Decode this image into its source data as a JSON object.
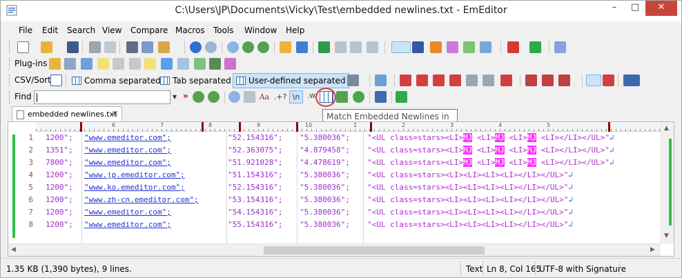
{
  "window": {
    "title": "C:\\Users\\JP\\Documents\\Vicky\\Test\\embedded newlines.txt - EmEditor",
    "minimize": "–",
    "maximize": "□",
    "close": "✕"
  },
  "menu": [
    "File",
    "Edit",
    "Search",
    "View",
    "Compare",
    "Macros",
    "Tools",
    "Window",
    "Help"
  ],
  "plugins_label": "Plug-ins",
  "csv": {
    "label": "CSV/Sort",
    "comma": "Comma separated",
    "tab": "Tab separated",
    "user": "User-defined separated"
  },
  "find": {
    "label": "Find",
    "value": "",
    "options": {
      "regex": ".+?",
      "newline": "\\n",
      "whole": ".W."
    }
  },
  "tooltip": "Match Embedded Newlines in CSV",
  "tab": {
    "name": "embedded newlines.txt",
    "close": "✕"
  },
  "ruler": [
    "6",
    "7",
    "8",
    "9",
    "10",
    "1",
    "2",
    "3",
    "4",
    "5"
  ],
  "lines": [
    {
      "n": "1",
      "c1": "1200\";",
      "c2": "\"www.emeditor.com\";",
      "c3": "\"52.154316\";",
      "c4": "\"5.380036\";",
      "c5": "\"<UL class=stars><LI>",
      "m": "MJ",
      "c6": " <LI>",
      "m2": "MJ",
      "c7": " <LI>",
      "m3": "MJ",
      "c8": " <LI></LI></UL>\"",
      "nl": "↲"
    },
    {
      "n": "2",
      "c1": "1351\";",
      "c2": "\"www.emeditor.com\";",
      "c3": "\"52.363075\";",
      "c4": "\"4.879458\";",
      "c5": "\"<UL class=stars><LI>",
      "m": "MJ",
      "c6": " <LI>",
      "m2": "MJ",
      "c7": " <LI>",
      "m3": "MJ",
      "c8": " <LI></LI></UL>\"",
      "nl": "↲"
    },
    {
      "n": "3",
      "c1": "7800\";",
      "c2": "\"www.emeditor.com\";",
      "c3": "\"51.921028\";",
      "c4": "\"4.478619\";",
      "c5": "\"<UL class=stars><LI>",
      "m": "MJ",
      "c6": " <LI>",
      "m2": "MJ",
      "c7": " <LI>",
      "m3": "MJ",
      "c8": " <LI></LI></UL>\"",
      "nl": "↲"
    },
    {
      "n": "4",
      "c1": "1200\";",
      "c2": "\"www.jp.emeditor.com\";",
      "c3": "\"51.154316\";",
      "c4": "\"5.380036\";",
      "c5": "\"<UL class=stars><LI><LI><LI><LI></LI></UL>\"",
      "nl": "↲"
    },
    {
      "n": "5",
      "c1": "1200\";",
      "c2": "\"www.ko.emeditor.com\";",
      "c3": "\"52.154316\";",
      "c4": "\"5.380036\";",
      "c5": "\"<UL class=stars><LI><LI><LI><LI></LI></UL>\"",
      "nl": "↲"
    },
    {
      "n": "6",
      "c1": "1200\";",
      "c2": "\"www.zh-cn.emeditor.com\";",
      "c3": "\"53.154316\";",
      "c4": "\"5.380036\";",
      "c5": "\"<UL class=stars><LI><LI><LI><LI></LI></UL>\"",
      "nl": "↲"
    },
    {
      "n": "7",
      "c1": "1200\";",
      "c2": "\"www.emeditor.com\";",
      "c3": "\"54.154316\";",
      "c4": "\"5.380036\";",
      "c5": "\"<UL class=stars><LI><LI><LI><LI></LI></UL>\"",
      "nl": "↲"
    },
    {
      "n": "8",
      "c1": "1200\";",
      "c2": "\"www.emeditor.com\";",
      "c3": "\"55.154316\";",
      "c4": "\"5.380036\";",
      "c5": "\"<UL class=stars><LI><LI><LI><LI></LI></UL>\"",
      "nl": "↲"
    }
  ],
  "status": {
    "info": "1.35 KB (1,390 bytes), 9 lines.",
    "mode": "Text",
    "position": "Ln 8, Col 165",
    "encoding": "UTF-8 with Signature"
  }
}
